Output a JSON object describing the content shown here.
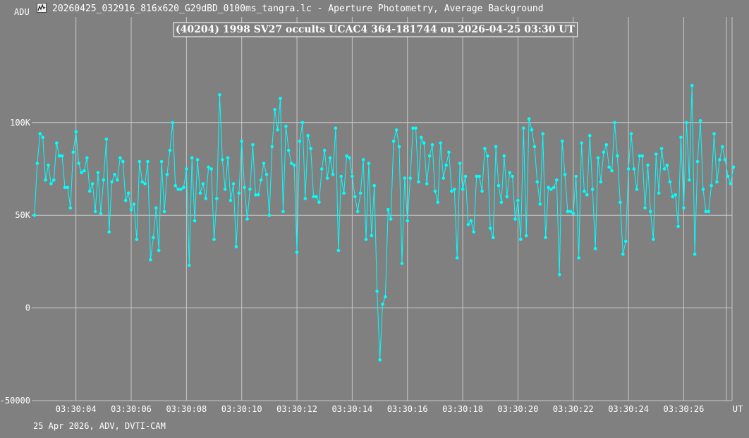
{
  "window": {
    "title": "20260425_032916_816x620_G29dBD_0100ms_tangra.lc - Aperture Photometry, Average Background",
    "icon": "light-curve-app-icon"
  },
  "footer": "25 Apr 2026, ADV, DVTI-CAM",
  "colors": {
    "background": "#808080",
    "grid": "#c8c8c8",
    "series": "#00ffff",
    "text": "#ffffff"
  },
  "chart_data": {
    "type": "line",
    "title": "(40204) 1998 SV27 occults UCAC4 364-181744 on 2026-04-25  03:30 UT",
    "ylabel": "ADU",
    "xlabel": "UT",
    "ylim": [
      -50000,
      157000
    ],
    "xlim": [
      2.4,
      27.75
    ],
    "y_ticks": [
      {
        "value": 100000,
        "label": "100K"
      },
      {
        "value": 50000,
        "label": "50K"
      },
      {
        "value": 0,
        "label": "0"
      },
      {
        "value": -50000,
        "label": "-50000"
      }
    ],
    "x_ticks": [
      {
        "value": 4,
        "label": "03:30:04"
      },
      {
        "value": 6,
        "label": "03:30:06"
      },
      {
        "value": 8,
        "label": "03:30:08"
      },
      {
        "value": 10,
        "label": "03:30:10"
      },
      {
        "value": 12,
        "label": "03:30:12"
      },
      {
        "value": 14,
        "label": "03:30:14"
      },
      {
        "value": 16,
        "label": "03:30:16"
      },
      {
        "value": 18,
        "label": "03:30:18"
      },
      {
        "value": 20,
        "label": "03:30:20"
      },
      {
        "value": 22,
        "label": "03:30:22"
      },
      {
        "value": 24,
        "label": "03:30:24"
      },
      {
        "value": 26,
        "label": "03:30:26"
      }
    ],
    "grid": true,
    "x_start": 2.5,
    "x_step": 0.1,
    "series": [
      {
        "values": [
          50000,
          78000,
          94000,
          92000,
          69000,
          77000,
          67000,
          69000,
          89000,
          82000,
          82000,
          65000,
          65000,
          54000,
          84000,
          95000,
          78000,
          73000,
          74000,
          81000,
          63000,
          67000,
          52000,
          73000,
          51000,
          69000,
          91000,
          41000,
          68000,
          72000,
          69000,
          81000,
          79000,
          58000,
          62000,
          53000,
          56000,
          37000,
          79000,
          68000,
          67000,
          79000,
          26000,
          38000,
          54000,
          31000,
          79000,
          52000,
          72000,
          85000,
          100000,
          66000,
          64000,
          64000,
          65000,
          75000,
          23000,
          81000,
          47000,
          80000,
          62000,
          67000,
          59000,
          76000,
          75000,
          37000,
          59000,
          115000,
          80000,
          64000,
          81000,
          58000,
          67000,
          33000,
          62000,
          90000,
          65000,
          48000,
          64000,
          88000,
          61000,
          61000,
          69000,
          78000,
          72000,
          50000,
          87000,
          107000,
          96000,
          113000,
          52000,
          98000,
          85000,
          78000,
          77000,
          30000,
          90000,
          100000,
          59000,
          93000,
          86000,
          60000,
          60000,
          57000,
          75000,
          85000,
          70000,
          81000,
          72000,
          97000,
          31000,
          71000,
          62000,
          82000,
          81000,
          71000,
          60000,
          52000,
          62000,
          80000,
          37000,
          78000,
          39000,
          66000,
          9000,
          -28000,
          2000,
          6000,
          53000,
          48000,
          90000,
          96000,
          87000,
          24000,
          70000,
          47000,
          70000,
          97000,
          97000,
          68000,
          92000,
          89000,
          67000,
          82000,
          88000,
          63000,
          57000,
          89000,
          70000,
          77000,
          84000,
          63000,
          64000,
          27000,
          78000,
          64000,
          71000,
          45000,
          47000,
          41000,
          71000,
          71000,
          63000,
          86000,
          82000,
          43000,
          38000,
          87000,
          66000,
          57000,
          82000,
          60000,
          73000,
          71000,
          48000,
          58000,
          37000,
          97000,
          39000,
          102000,
          96000,
          87000,
          68000,
          56000,
          94000,
          38000,
          65000,
          64000,
          65000,
          69000,
          18000,
          90000,
          72000,
          52000,
          52000,
          51000,
          71000,
          27000,
          89000,
          63000,
          61000,
          93000,
          64000,
          32000,
          81000,
          68000,
          84000,
          88000,
          76000,
          74000,
          100000,
          82000,
          57000,
          29000,
          36000,
          75000,
          94000,
          75000,
          64000,
          82000,
          82000,
          54000,
          77000,
          52000,
          37000,
          83000,
          62000,
          86000,
          75000,
          77000,
          68000,
          60000,
          61000,
          44000,
          92000,
          54000,
          100000,
          69000,
          120000,
          29000,
          79000,
          101000,
          64000,
          52000,
          52000,
          66000,
          94000,
          68000,
          80000,
          87000,
          80000,
          71000,
          67000,
          76000
        ]
      }
    ]
  }
}
